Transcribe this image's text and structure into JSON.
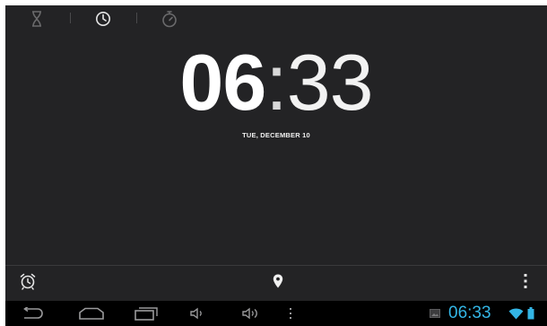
{
  "tabs": [
    {
      "icon": "hourglass-icon",
      "label": "Timer",
      "active": false
    },
    {
      "icon": "clock-icon",
      "label": "Clock",
      "active": true
    },
    {
      "icon": "stopwatch-icon",
      "label": "Stopwatch",
      "active": false
    }
  ],
  "clock": {
    "hours": "06",
    "separator": ":",
    "minutes": "33"
  },
  "date": "TUE, DECEMBER 10",
  "actions": {
    "left_icon": "alarm-icon",
    "center_icon": "location-pin-icon",
    "right_icon": "overflow-menu-icon"
  },
  "navbar": {
    "buttons": [
      "back-icon",
      "home-icon",
      "recent-apps-icon",
      "volume-down-icon",
      "volume-up-icon",
      "menu-dots-icon"
    ],
    "status_time": "06:33",
    "status_icons": [
      "gallery-notification-icon",
      "wifi-icon",
      "battery-icon"
    ]
  },
  "colors": {
    "background": "#232325",
    "navbar": "#000000",
    "accent": "#33b5e5",
    "text": "#ffffff"
  }
}
